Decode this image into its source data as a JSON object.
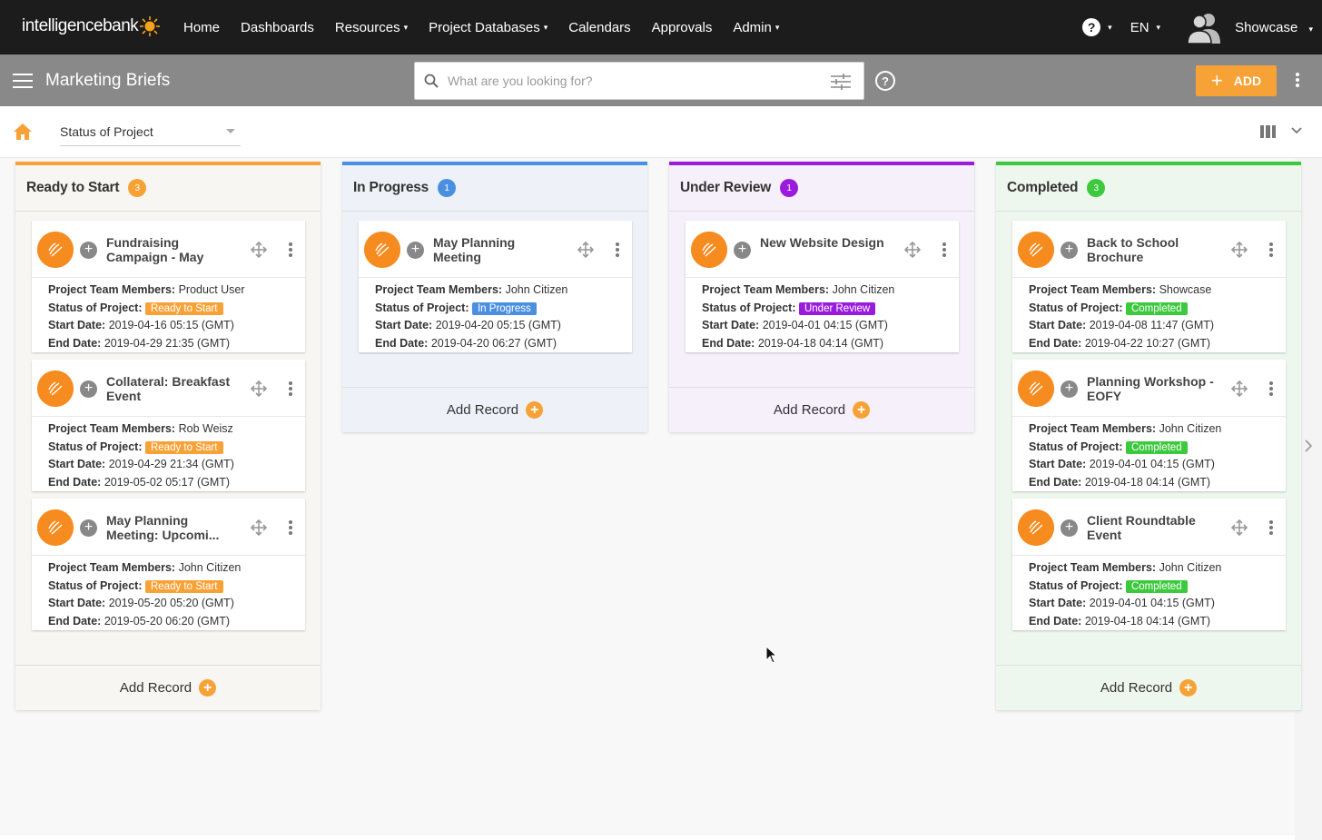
{
  "brand": {
    "logo_text": "intelligencebank",
    "sun_color": "#f7a21b"
  },
  "nav": {
    "items": [
      {
        "label": "Home",
        "has_dropdown": false
      },
      {
        "label": "Dashboards",
        "has_dropdown": false
      },
      {
        "label": "Resources",
        "has_dropdown": true
      },
      {
        "label": "Project Databases",
        "has_dropdown": true
      },
      {
        "label": "Calendars",
        "has_dropdown": false
      },
      {
        "label": "Approvals",
        "has_dropdown": false
      },
      {
        "label": "Admin",
        "has_dropdown": true
      }
    ],
    "caret": "▾",
    "help_glyph": "?",
    "language": "EN",
    "user_name": "Showcase"
  },
  "subbar": {
    "page_title": "Marketing Briefs",
    "search_placeholder": "What are you looking for?",
    "help_glyph": "?",
    "add_label": "ADD",
    "add_plus": "+"
  },
  "toolbar": {
    "group_by": "Status of Project"
  },
  "labels": {
    "team": "Project Team Members:",
    "status": "Status of Project:",
    "start": "Start Date:",
    "end": "End Date:",
    "add_record": "Add Record",
    "plus": "+"
  },
  "columns": [
    {
      "title": "Ready to Start",
      "count": "3",
      "color": "#f7a237",
      "bg": "#f8f6f2",
      "cards": [
        {
          "title": "Fundraising Campaign - May",
          "team": "Product User",
          "status": "Ready to Start",
          "start": "2019-04-16 05:15 (GMT)",
          "end": "2019-04-29 21:35 (GMT)"
        },
        {
          "title": "Collateral: Breakfast Event",
          "team": "Rob Weisz",
          "status": "Ready to Start",
          "start": "2019-04-29 21:34 (GMT)",
          "end": "2019-05-02 05:17 (GMT)"
        },
        {
          "title": "May Planning Meeting: Upcomi...",
          "team": "John Citizen",
          "status": "Ready to Start",
          "start": "2019-05-20 05:20 (GMT)",
          "end": "2019-05-20 06:20 (GMT)"
        }
      ]
    },
    {
      "title": "In Progress",
      "count": "1",
      "color": "#4a8fe0",
      "bg": "#eef2f8",
      "cards": [
        {
          "title": "May Planning Meeting",
          "team": "John Citizen",
          "status": "In Progress",
          "start": "2019-04-20 05:15 (GMT)",
          "end": "2019-04-20 06:27 (GMT)"
        }
      ]
    },
    {
      "title": "Under Review",
      "count": "1",
      "color": "#9a1bdc",
      "bg": "#f5f0fa",
      "cards": [
        {
          "title": "New Website Design",
          "team": "John Citizen",
          "status": "Under Review",
          "start": "2019-04-01 04:15 (GMT)",
          "end": "2019-04-18 04:14 (GMT)"
        }
      ]
    },
    {
      "title": "Completed",
      "count": "3",
      "color": "#3dc93d",
      "bg": "#eef7ee",
      "cards": [
        {
          "title": "Back to School Brochure",
          "team": "Showcase",
          "status": "Completed",
          "start": "2019-04-08 11:47 (GMT)",
          "end": "2019-04-22 10:27 (GMT)"
        },
        {
          "title": "Planning Workshop - EOFY",
          "team": "John Citizen",
          "status": "Completed",
          "start": "2019-04-01 04:15 (GMT)",
          "end": "2019-04-18 04:14 (GMT)"
        },
        {
          "title": "Client Roundtable Event",
          "team": "John Citizen",
          "status": "Completed",
          "start": "2019-04-01 04:15 (GMT)",
          "end": "2019-04-18 04:14 (GMT)"
        }
      ]
    }
  ]
}
